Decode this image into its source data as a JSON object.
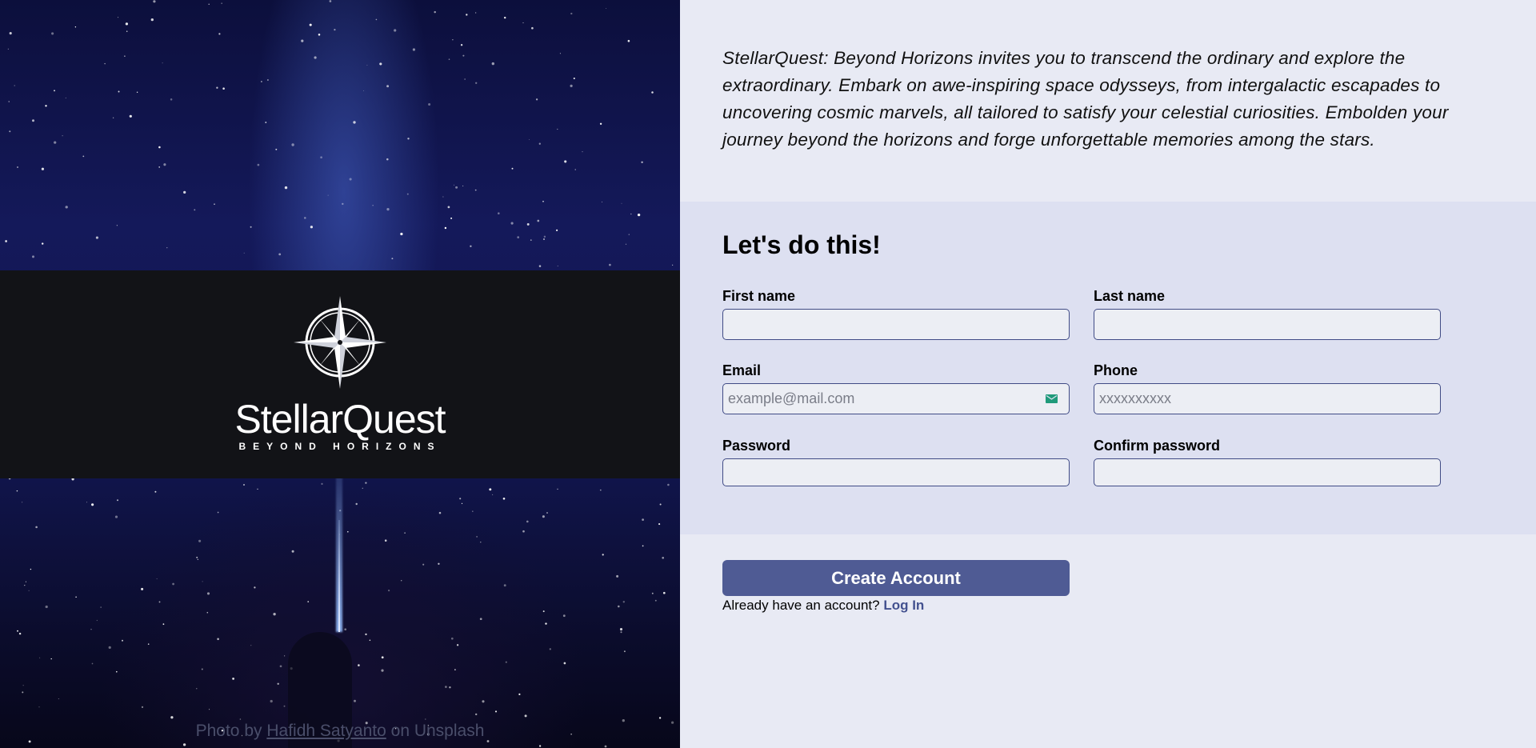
{
  "hero": {
    "brand_name": "StellarQuest",
    "tagline": "BEYOND HORIZONS",
    "credit": {
      "prefix": "Photo by",
      "author": "Hafidh Satyanto",
      "suffix": "on Unsplash"
    }
  },
  "intro": {
    "text": "StellarQuest: Beyond Horizons invites you to transcend the ordinary and explore the extraordinary. Embark on awe-inspiring space odysseys, from intergalactic escapades to uncovering cosmic marvels, all tailored to satisfy your celestial curiosities. Embolden your journey beyond the horizons and forge unforgettable memories among the stars."
  },
  "form": {
    "title": "Let's do this!",
    "first_name": {
      "label": "First name",
      "value": "",
      "placeholder": ""
    },
    "last_name": {
      "label": "Last name",
      "value": "",
      "placeholder": ""
    },
    "email": {
      "label": "Email",
      "value": "",
      "placeholder": "example@mail.com",
      "icon": "mail-icon"
    },
    "phone": {
      "label": "Phone",
      "value": "",
      "placeholder": "xxxxxxxxxx"
    },
    "password": {
      "label": "Password",
      "value": "",
      "placeholder": ""
    },
    "confirm_password": {
      "label": "Confirm password",
      "value": "",
      "placeholder": ""
    }
  },
  "actions": {
    "create_label": "Create Account",
    "login_prompt": "Already have an account?",
    "login_link": "Log In"
  },
  "colors": {
    "accent": "#4f5b94",
    "link": "#43518f",
    "input_border": "#404b85",
    "panel_bg": "#e8eaf4",
    "form_bg": "#dde0f1",
    "band_bg": "#121317",
    "mail_icon": "#1f9a7a"
  }
}
